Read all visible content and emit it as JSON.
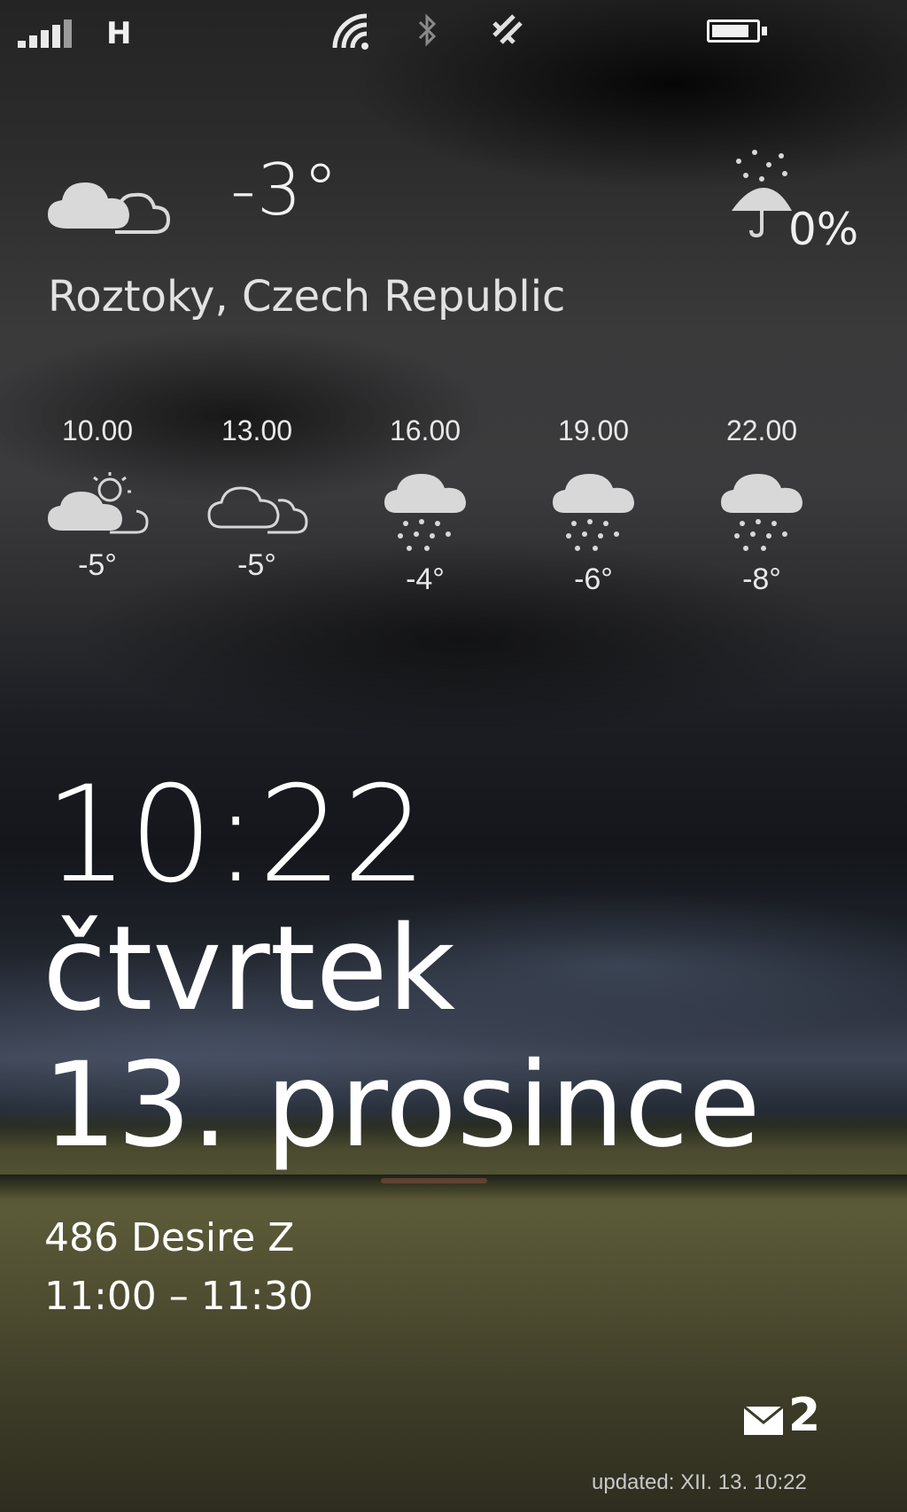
{
  "status_bar": {
    "signal_icon": "signal-bars-icon",
    "network_type": "H",
    "wifi_icon": "wifi-icon",
    "bluetooth_icon": "bluetooth-icon",
    "sync_icon": "sync-icon",
    "battery_icon": "battery-icon",
    "battery_level": 0.85
  },
  "weather": {
    "current_icon": "cloudy-icon",
    "current_temp": "-3°",
    "precip_icon": "umbrella-rain-icon",
    "precip_chance": "0%",
    "location": "Roztoky, Czech Republic",
    "hourly": [
      {
        "time": "10.00",
        "icon": "partly-sunny-icon",
        "temp": "-5°"
      },
      {
        "time": "13.00",
        "icon": "cloudy-icon",
        "temp": "-5°"
      },
      {
        "time": "16.00",
        "icon": "snow-icon",
        "temp": "-4°"
      },
      {
        "time": "19.00",
        "icon": "snow-icon",
        "temp": "-6°"
      },
      {
        "time": "22.00",
        "icon": "snow-icon",
        "temp": "-8°"
      }
    ]
  },
  "lock": {
    "time": "10:22",
    "day": "čtvrtek",
    "date": "13. prosince"
  },
  "calendar": {
    "title": "486 Desire Z",
    "time": "11:00 – 11:30"
  },
  "notifications": {
    "mail_icon": "mail-icon",
    "mail_count": "2",
    "updated": "updated: XII. 13. 10:22"
  }
}
